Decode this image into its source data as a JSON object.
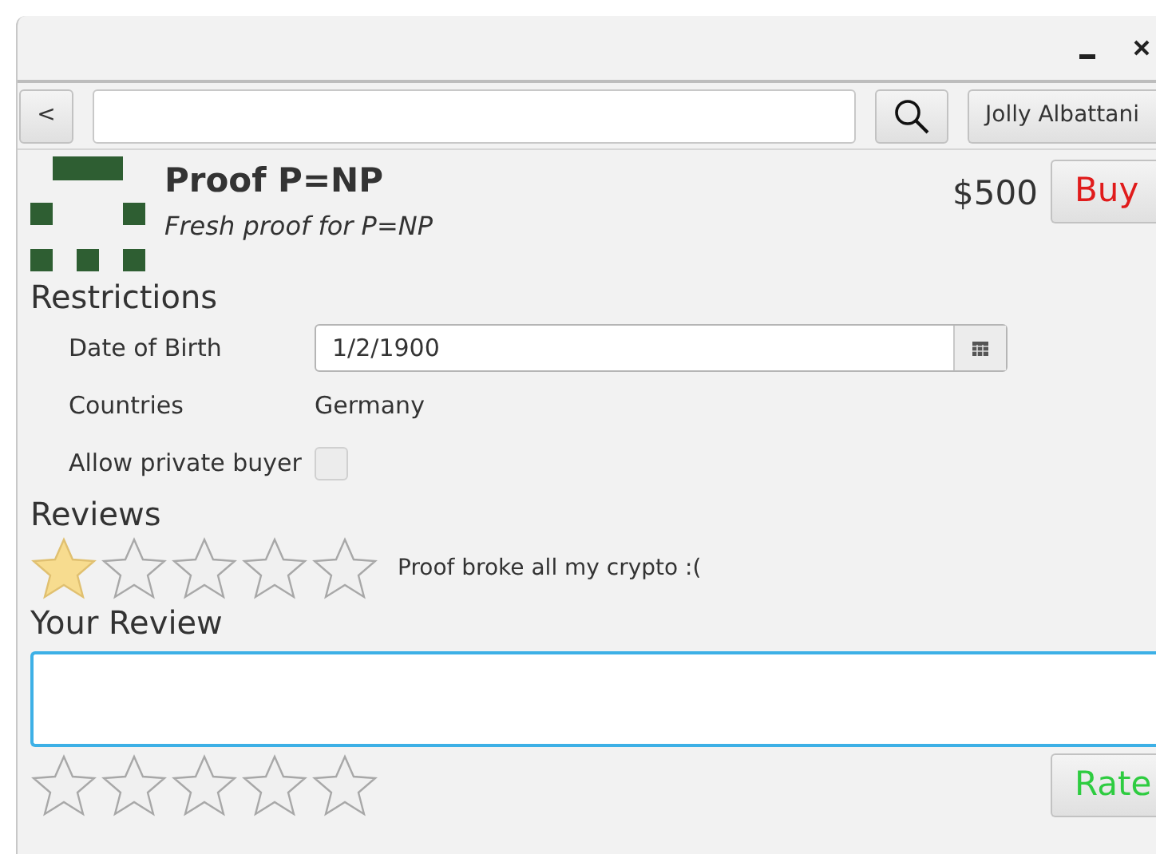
{
  "toolbar": {
    "back_label": "<",
    "user_label": "Jolly Albattani"
  },
  "product": {
    "title": "Proof P=NP",
    "subtitle": "Fresh proof for P=NP",
    "price": "$500",
    "buy_label": "Buy"
  },
  "restrictions": {
    "heading": "Restrictions",
    "fields": [
      {
        "kind": "date",
        "label": "Date of Birth",
        "value": "1/2/1900"
      },
      {
        "kind": "text",
        "label": "Countries",
        "value": "Germany"
      },
      {
        "kind": "checkbox",
        "label": "Allow private buyer",
        "checked": false
      }
    ]
  },
  "reviews": {
    "heading": "Reviews",
    "items": [
      {
        "stars": 1,
        "text": "Proof broke all my crypto :("
      }
    ]
  },
  "your_review": {
    "heading": "Your Review",
    "focused": true,
    "stars": 0,
    "rate_label": "Rate"
  }
}
